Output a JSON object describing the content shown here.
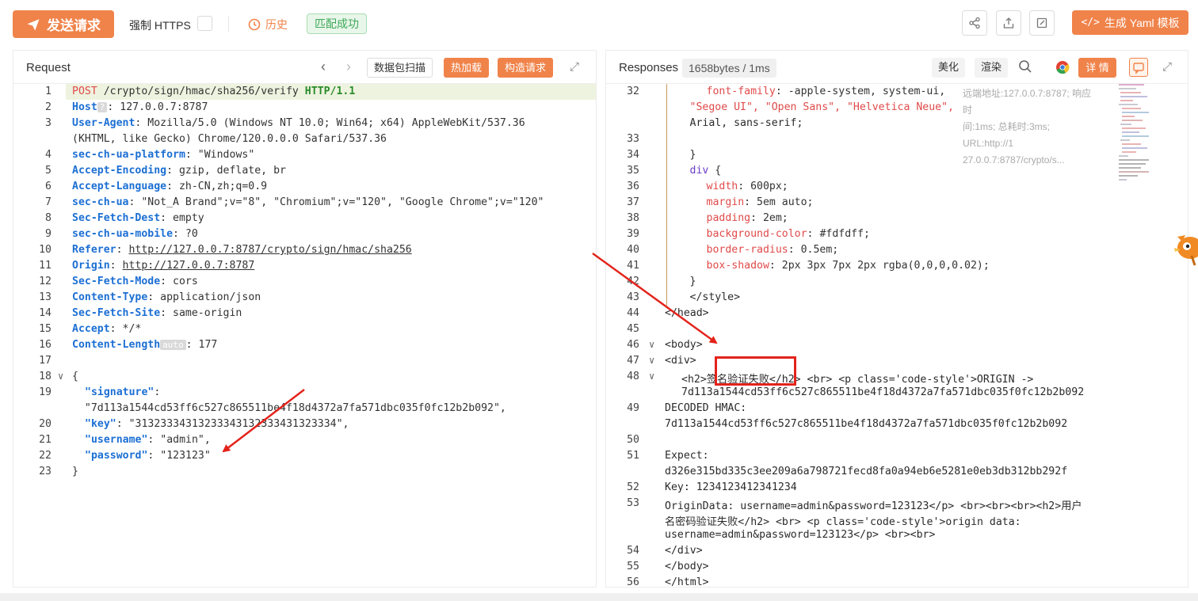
{
  "toolbar": {
    "send_label": "发送请求",
    "https_label": "强制 HTTPS",
    "history_label": "历史",
    "match_label": "匹配成功",
    "yaml_label": "生成 Yaml 模板",
    "icons": [
      "share-icon",
      "export-icon",
      "edit-icon"
    ]
  },
  "request": {
    "title": "Request",
    "btn_scan": "数据包扫描",
    "btn_hotload": "热加载",
    "btn_build": "构造请求"
  },
  "response": {
    "title": "Responses",
    "size": "1658bytes / 1ms",
    "btn_beautify": "美化",
    "btn_render": "渲染",
    "btn_detail": "详 情",
    "tooltip_line1": "远端地址:127.0.0.7:8787; 响应时",
    "tooltip_line2": "间:1ms; 总耗时:3ms; URL:http://1",
    "tooltip_line3": "27.0.0.7:8787/crypto/s..."
  },
  "request_lines": [
    {
      "n": "1",
      "method": "POST",
      "path": " /crypto/sign/hmac/sha256/verify ",
      "proto": "HTTP/1.1"
    },
    {
      "n": "2",
      "k": "Host",
      "badge": "?",
      "v": ": 127.0.0.7:8787"
    },
    {
      "n": "3",
      "k": "User-Agent",
      "v": ": Mozilla/5.0 (Windows NT 10.0; Win64; x64) AppleWebKit/537.36"
    },
    {
      "n": "",
      "k": "",
      "v": "(KHTML, like Gecko) Chrome/120.0.0.0 Safari/537.36"
    },
    {
      "n": "4",
      "k": "sec-ch-ua-platform",
      "v": ": \"Windows\""
    },
    {
      "n": "5",
      "k": "Accept-Encoding",
      "v": ": gzip, deflate, br"
    },
    {
      "n": "6",
      "k": "Accept-Language",
      "v": ": zh-CN,zh;q=0.9"
    },
    {
      "n": "7",
      "k": "sec-ch-ua",
      "v": ": \"Not_A Brand\";v=\"8\", \"Chromium\";v=\"120\", \"Google Chrome\";v=\"120\""
    },
    {
      "n": "8",
      "k": "Sec-Fetch-Dest",
      "v": ": empty"
    },
    {
      "n": "9",
      "k": "sec-ch-ua-mobile",
      "v": ": ?0"
    },
    {
      "n": "10",
      "k": "Referer",
      "v": ": ",
      "link": "http://127.0.0.7:8787/crypto/sign/hmac/sha256"
    },
    {
      "n": "11",
      "k": "Origin",
      "v": ": ",
      "link": "http://127.0.0.7:8787"
    },
    {
      "n": "12",
      "k": "Sec-Fetch-Mode",
      "v": ": cors"
    },
    {
      "n": "13",
      "k": "Content-Type",
      "v": ": application/json"
    },
    {
      "n": "14",
      "k": "Sec-Fetch-Site",
      "v": ": same-origin"
    },
    {
      "n": "15",
      "k": "Accept",
      "v": ": */*"
    },
    {
      "n": "16",
      "k": "Content-Length",
      "badge": "auto",
      "v": ": 177"
    },
    {
      "n": "17",
      "k": "",
      "v": ""
    },
    {
      "n": "18",
      "k": "",
      "v": "{"
    },
    {
      "n": "19",
      "jk": "\"signature\"",
      "v": ":"
    },
    {
      "n": "",
      "k": "",
      "v": "  \"7d113a1544cd53ff6c527c865511be4f18d4372a7fa571dbc035f0fc12b2b092\","
    },
    {
      "n": "20",
      "jk": "\"key\"",
      "v": ": \"31323334313233343132333431323334\","
    },
    {
      "n": "21",
      "jk": "\"username\"",
      "v": ": \"admin\","
    },
    {
      "n": "22",
      "jk": "\"password\"",
      "v": ": \"123123\""
    },
    {
      "n": "23",
      "k": "",
      "v": "}"
    }
  ],
  "response_lines": [
    {
      "n": "32",
      "t": "font-family: -apple-system, system-ui, \"Segoe UI\", \"Open Sans\", \"Helvetica Neue\","
    },
    {
      "n": "",
      "t": "\"Segoe UI\", \"Open Sans\", \"Helvetica Neue\","
    },
    {
      "n": "",
      "t": "Arial, sans-serif;"
    },
    {
      "n": "33",
      "t": ""
    },
    {
      "n": "34",
      "t": "}"
    },
    {
      "n": "35",
      "t": "div {"
    },
    {
      "n": "36",
      "t": "width: 600px;"
    },
    {
      "n": "37",
      "t": "margin: 5em auto;"
    },
    {
      "n": "38",
      "t": "padding: 2em;"
    },
    {
      "n": "39",
      "t": "background-color: #fdfdff;"
    },
    {
      "n": "40",
      "t": "border-radius: 0.5em;"
    },
    {
      "n": "41",
      "t": "box-shadow: 2px 3px 7px 2px rgba(0,0,0,0.02);"
    },
    {
      "n": "42",
      "t": "}"
    },
    {
      "n": "43",
      "t": "</style>"
    },
    {
      "n": "44",
      "t": "</head>"
    },
    {
      "n": "45",
      "t": ""
    },
    {
      "n": "46",
      "t": "<body>"
    },
    {
      "n": "47",
      "t": "<div>"
    },
    {
      "n": "48",
      "t": "<h2>签名验证失败</h2> <br> <p class='code-style'>ORIGIN ->"
    },
    {
      "n": "",
      "t": "7d113a1544cd53ff6c527c865511be4f18d4372a7fa571dbc035f0fc12b2b092"
    },
    {
      "n": "49",
      "t": "DECODED HMAC:"
    },
    {
      "n": "",
      "t": "7d113a1544cd53ff6c527c865511be4f18d4372a7fa571dbc035f0fc12b2b092"
    },
    {
      "n": "50",
      "t": ""
    },
    {
      "n": "51",
      "t": "Expect:"
    },
    {
      "n": "",
      "t": "d326e315bd335c3ee209a6a798721fecd8fa0a94eb6e5281e0eb3db312bb292f"
    },
    {
      "n": "52",
      "t": "Key: 1234123412341234"
    },
    {
      "n": "53",
      "t": "OriginData: username=admin&password=123123</p> <br><br><br><h2>用户"
    },
    {
      "n": "",
      "t": "名密码验证失败</h2> <br> <p class='code-style'>origin data:"
    },
    {
      "n": "",
      "t": "username=admin&password=123123</p> <br><br>"
    },
    {
      "n": "54",
      "t": "</div>"
    },
    {
      "n": "55",
      "t": "</body>"
    },
    {
      "n": "56",
      "t": "</html>"
    }
  ],
  "colors": {
    "accent": "#f0834a",
    "success": "#40a85a",
    "annotation": "#e3231b"
  }
}
